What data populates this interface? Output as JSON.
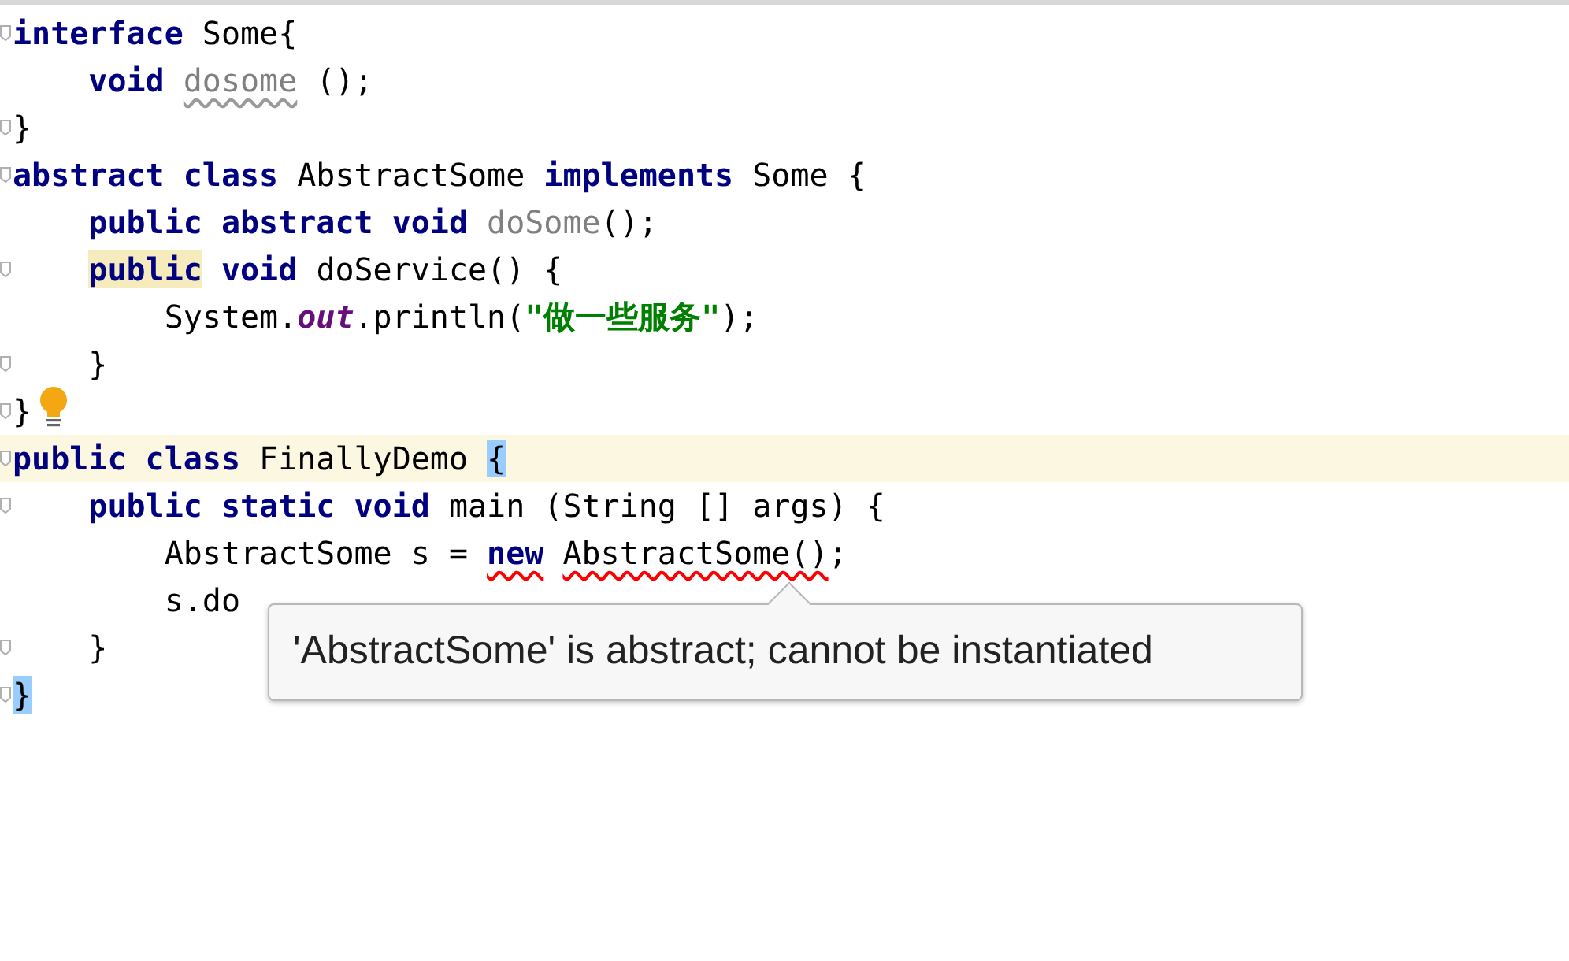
{
  "editor": {
    "lines": [
      {
        "fold": true,
        "current": false,
        "bulb": false,
        "tokens": [
          {
            "kind": "keyword",
            "t": "interface"
          },
          {
            "kind": "plain",
            "t": " Some{"
          }
        ]
      },
      {
        "fold": false,
        "current": false,
        "bulb": false,
        "tokens": [
          {
            "kind": "keyword",
            "t": "    void "
          },
          {
            "kind": "unused-warning",
            "t": "dosome"
          },
          {
            "kind": "plain",
            "t": " ();"
          }
        ]
      },
      {
        "fold": true,
        "current": false,
        "bulb": false,
        "tokens": [
          {
            "kind": "plain",
            "t": "}"
          }
        ]
      },
      {
        "fold": true,
        "current": false,
        "bulb": false,
        "tokens": [
          {
            "kind": "keyword",
            "t": "abstract class"
          },
          {
            "kind": "plain",
            "t": " AbstractSome "
          },
          {
            "kind": "keyword",
            "t": "implements"
          },
          {
            "kind": "plain",
            "t": " Some {"
          }
        ]
      },
      {
        "fold": false,
        "current": false,
        "bulb": false,
        "tokens": [
          {
            "kind": "keyword",
            "t": "    public abstract void "
          },
          {
            "kind": "unused",
            "t": "doSome"
          },
          {
            "kind": "plain",
            "t": "();"
          }
        ]
      },
      {
        "fold": true,
        "current": false,
        "bulb": false,
        "tokens": [
          {
            "kind": "usage-highlight",
            "t": "    public"
          },
          {
            "kind": "keyword",
            "t": " void"
          },
          {
            "kind": "plain",
            "t": " doService() {"
          }
        ]
      },
      {
        "fold": false,
        "current": false,
        "bulb": false,
        "tokens": [
          {
            "kind": "plain",
            "t": "        System."
          },
          {
            "kind": "field",
            "t": "out"
          },
          {
            "kind": "plain",
            "t": ".println("
          },
          {
            "kind": "string",
            "t": "\"做一些服务\""
          },
          {
            "kind": "plain",
            "t": ");"
          }
        ]
      },
      {
        "fold": true,
        "current": false,
        "bulb": false,
        "tokens": [
          {
            "kind": "plain",
            "t": "    }"
          }
        ]
      },
      {
        "fold": true,
        "current": false,
        "bulb": true,
        "tokens": [
          {
            "kind": "plain",
            "t": "}"
          }
        ]
      },
      {
        "fold": true,
        "current": true,
        "bulb": false,
        "tokens": [
          {
            "kind": "keyword",
            "t": "public class"
          },
          {
            "kind": "plain",
            "t": " FinallyDemo "
          },
          {
            "kind": "brace-match",
            "t": "{"
          }
        ]
      },
      {
        "fold": true,
        "current": false,
        "bulb": false,
        "tokens": [
          {
            "kind": "keyword",
            "t": "    public static void"
          },
          {
            "kind": "plain",
            "t": " main (String [] args) {"
          }
        ]
      },
      {
        "fold": false,
        "current": false,
        "bulb": false,
        "tokens": [
          {
            "kind": "plain",
            "t": "        AbstractSome s = "
          },
          {
            "kind": "error-keyword",
            "t": "new"
          },
          {
            "kind": "error-plain",
            "t": " AbstractSome()"
          },
          {
            "kind": "plain",
            "t": ";"
          }
        ]
      },
      {
        "fold": false,
        "current": false,
        "bulb": false,
        "tokens": [
          {
            "kind": "plain",
            "t": "        s.do"
          }
        ]
      },
      {
        "fold": true,
        "current": false,
        "bulb": false,
        "tokens": [
          {
            "kind": "plain",
            "t": "    }"
          }
        ]
      },
      {
        "fold": true,
        "current": false,
        "bulb": false,
        "tokens": [
          {
            "kind": "brace-match",
            "t": "}"
          }
        ]
      }
    ]
  },
  "tooltip": {
    "text": "'AbstractSome' is abstract; cannot be instantiated"
  }
}
